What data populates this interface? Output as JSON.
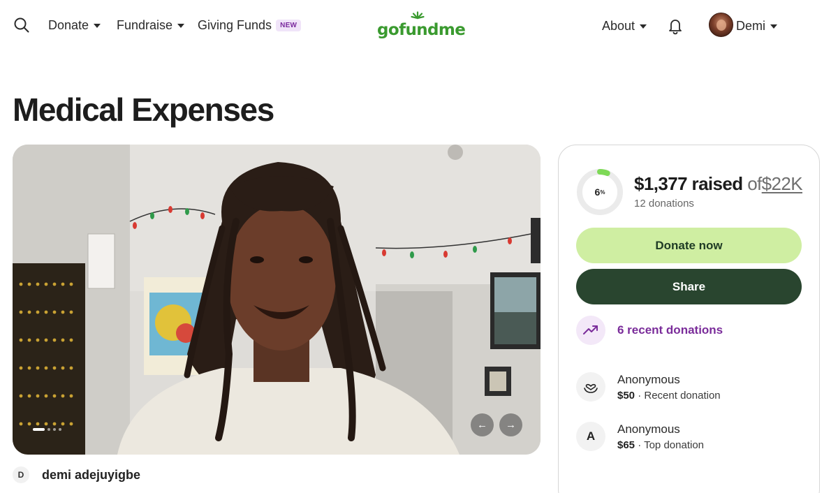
{
  "nav": {
    "items": [
      {
        "label": "Donate"
      },
      {
        "label": "Fundraise"
      },
      {
        "label": "Giving Funds",
        "badge": "NEW"
      }
    ],
    "logo_text": "gofundme",
    "about_label": "About",
    "user_name": "Demi"
  },
  "page": {
    "title": "Medical Expenses"
  },
  "organizer": {
    "initial": "D",
    "name": "demi adejuyigbe"
  },
  "progress": {
    "percent_label": "6",
    "percent_symbol": "%",
    "fraction": 0.06,
    "raised": "$1,377 raised",
    "of": "of",
    "goal": "$22K",
    "donation_count": "12 donations"
  },
  "actions": {
    "donate_label": "Donate now",
    "share_label": "Share"
  },
  "recent": {
    "label": "6 recent donations"
  },
  "donations": [
    {
      "name": "Anonymous",
      "amount": "$50",
      "sep": " · ",
      "type": "Recent donation",
      "icon": "hand-heart-icon"
    },
    {
      "name": "Anonymous",
      "amount": "$65",
      "sep": " · ",
      "type": "Top donation",
      "initial": "A"
    }
  ],
  "colors": {
    "brand_green": "#3a9a2f",
    "donate_bg": "#cfeea2",
    "share_bg": "#29452f",
    "recent_purple": "#7a2c9a",
    "new_badge_bg": "#f0e4f9"
  },
  "carousel": {
    "prev_arrow": "←",
    "next_arrow": "→",
    "slide_count": 4,
    "active_slide": 1
  }
}
